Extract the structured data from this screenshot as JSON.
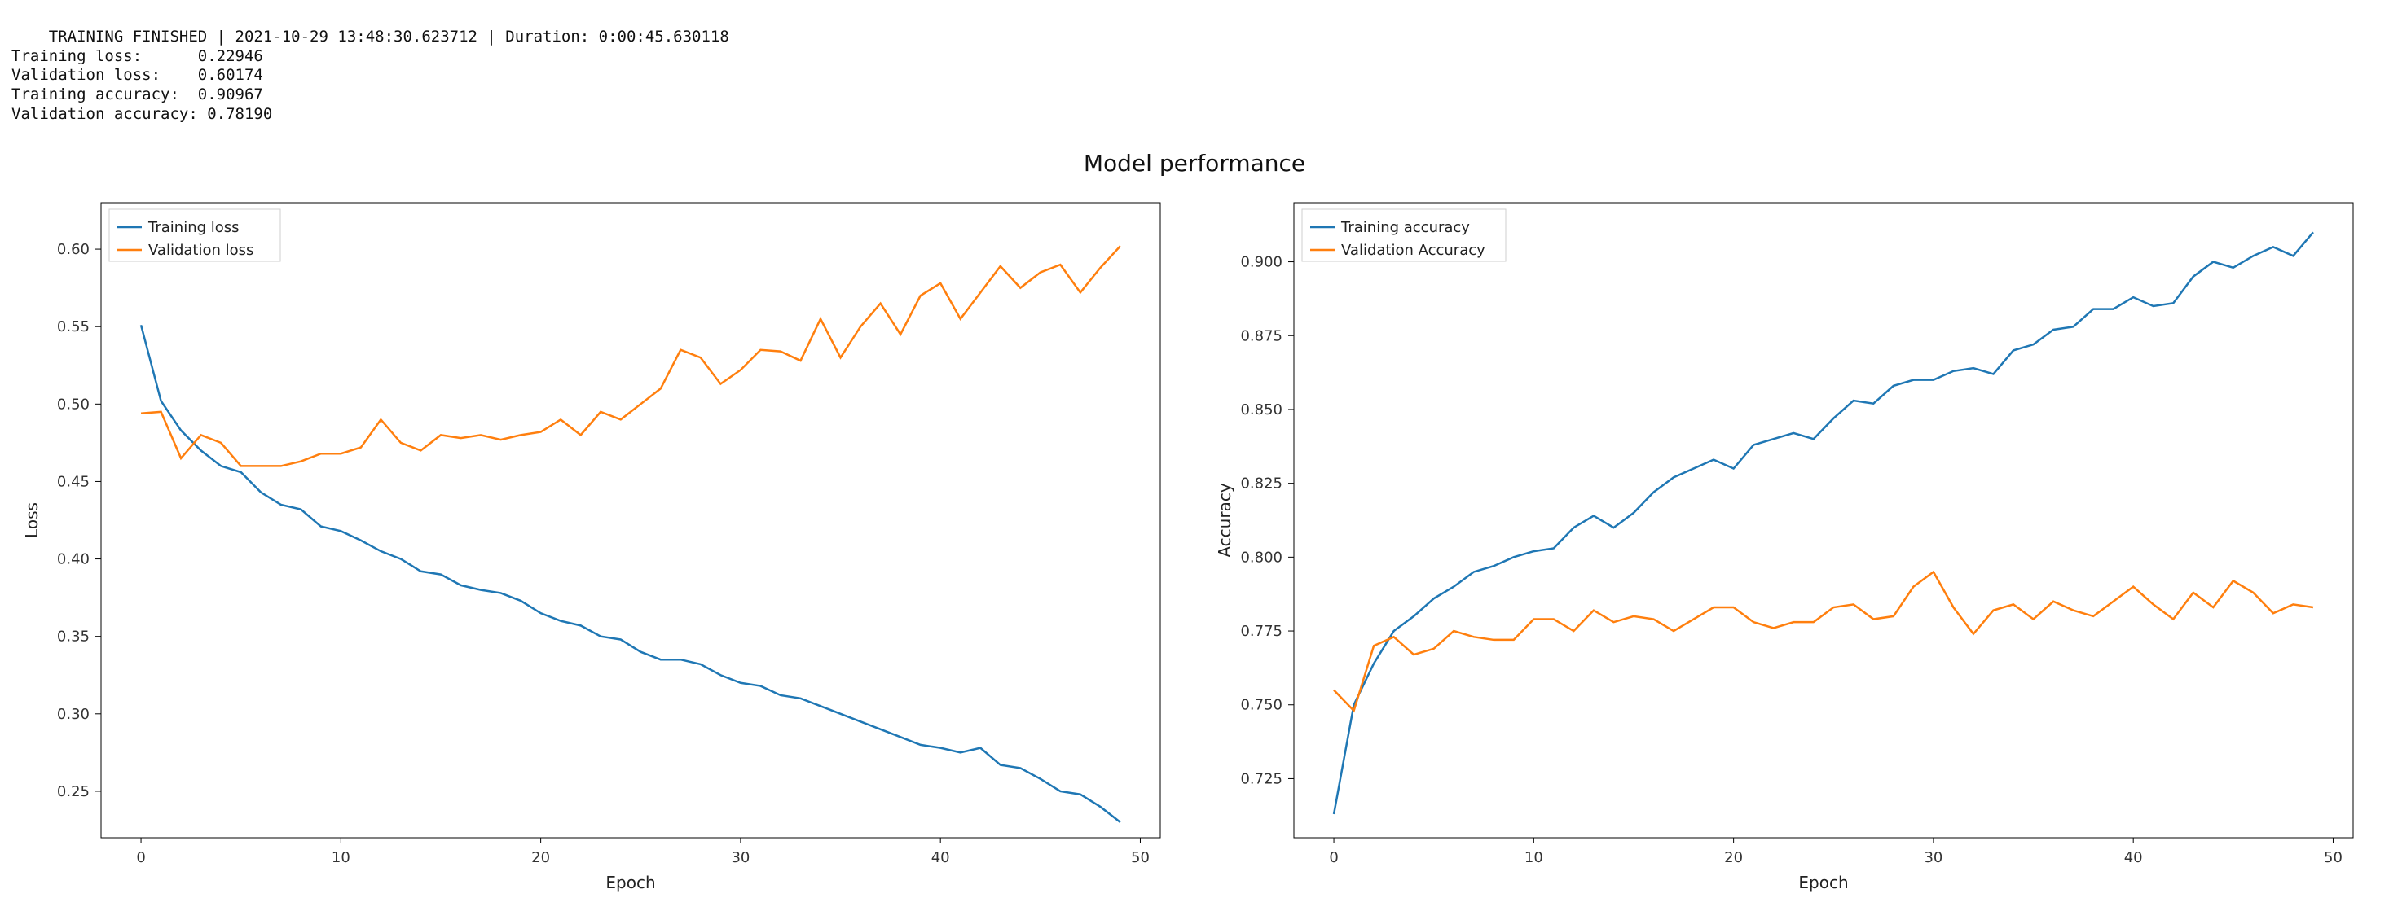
{
  "log": {
    "header": "TRAINING FINISHED | 2021-10-29 13:48:30.623712 | Duration: 0:00:45.630118",
    "rows": [
      {
        "label": "Training loss:",
        "pad": "      ",
        "value": "0.22946"
      },
      {
        "label": "Validation loss:",
        "pad": "    ",
        "value": "0.60174"
      },
      {
        "label": "Training accuracy:",
        "pad": "  ",
        "value": "0.90967"
      },
      {
        "label": "Validation accuracy:",
        "pad": " ",
        "value": "0.78190"
      }
    ]
  },
  "suptitle": "Model performance",
  "colors": {
    "series0": "#1f77b4",
    "series1": "#ff7f0e",
    "axis": "#000000"
  },
  "charts": [
    {
      "ylabel": "Loss",
      "xlabel": "Epoch",
      "xlim": [
        -2,
        51
      ],
      "xticks": [
        0,
        10,
        20,
        30,
        40,
        50
      ],
      "ylim": [
        0.22,
        0.63
      ],
      "yticks": [
        0.25,
        0.3,
        0.35,
        0.4,
        0.45,
        0.5,
        0.55,
        0.6
      ],
      "legend_pos": "upper-left",
      "series": [
        {
          "name": "Training loss",
          "color_key": "series0"
        },
        {
          "name": "Validation loss",
          "color_key": "series1"
        }
      ]
    },
    {
      "ylabel": "Accuracy",
      "xlabel": "Epoch",
      "xlim": [
        -2,
        51
      ],
      "xticks": [
        0,
        10,
        20,
        30,
        40,
        50
      ],
      "ylim": [
        0.705,
        0.92
      ],
      "yticks": [
        0.725,
        0.75,
        0.775,
        0.8,
        0.825,
        0.85,
        0.875,
        0.9
      ],
      "legend_pos": "upper-left",
      "series": [
        {
          "name": "Training accuracy",
          "color_key": "series0"
        },
        {
          "name": "Validation Accuracy",
          "color_key": "series1"
        }
      ]
    }
  ],
  "chart_data": [
    {
      "type": "line",
      "title": "",
      "xlabel": "Epoch",
      "ylabel": "Loss",
      "xlim": [
        -2,
        51
      ],
      "ylim": [
        0.22,
        0.63
      ],
      "x": [
        0,
        1,
        2,
        3,
        4,
        5,
        6,
        7,
        8,
        9,
        10,
        11,
        12,
        13,
        14,
        15,
        16,
        17,
        18,
        19,
        20,
        21,
        22,
        23,
        24,
        25,
        26,
        27,
        28,
        29,
        30,
        31,
        32,
        33,
        34,
        35,
        36,
        37,
        38,
        39,
        40,
        41,
        42,
        43,
        44,
        45,
        46,
        47,
        48,
        49
      ],
      "series": [
        {
          "name": "Training loss",
          "values": [
            0.551,
            0.502,
            0.483,
            0.47,
            0.46,
            0.456,
            0.443,
            0.435,
            0.432,
            0.421,
            0.418,
            0.412,
            0.405,
            0.4,
            0.392,
            0.39,
            0.383,
            0.38,
            0.378,
            0.373,
            0.365,
            0.36,
            0.357,
            0.35,
            0.348,
            0.34,
            0.335,
            0.335,
            0.332,
            0.325,
            0.32,
            0.318,
            0.312,
            0.31,
            0.305,
            0.3,
            0.295,
            0.29,
            0.285,
            0.28,
            0.278,
            0.275,
            0.278,
            0.267,
            0.265,
            0.258,
            0.25,
            0.248,
            0.24,
            0.23
          ]
        },
        {
          "name": "Validation loss",
          "values": [
            0.494,
            0.495,
            0.465,
            0.48,
            0.475,
            0.46,
            0.46,
            0.46,
            0.463,
            0.468,
            0.468,
            0.472,
            0.49,
            0.475,
            0.47,
            0.48,
            0.478,
            0.48,
            0.477,
            0.48,
            0.482,
            0.49,
            0.48,
            0.495,
            0.49,
            0.5,
            0.51,
            0.535,
            0.53,
            0.513,
            0.522,
            0.535,
            0.534,
            0.528,
            0.555,
            0.53,
            0.55,
            0.565,
            0.545,
            0.57,
            0.578,
            0.555,
            0.572,
            0.589,
            0.575,
            0.585,
            0.59,
            0.572,
            0.588,
            0.602
          ]
        }
      ]
    },
    {
      "type": "line",
      "title": "",
      "xlabel": "Epoch",
      "ylabel": "Accuracy",
      "xlim": [
        -2,
        51
      ],
      "ylim": [
        0.705,
        0.92
      ],
      "x": [
        0,
        1,
        2,
        3,
        4,
        5,
        6,
        7,
        8,
        9,
        10,
        11,
        12,
        13,
        14,
        15,
        16,
        17,
        18,
        19,
        20,
        21,
        22,
        23,
        24,
        25,
        26,
        27,
        28,
        29,
        30,
        31,
        32,
        33,
        34,
        35,
        36,
        37,
        38,
        39,
        40,
        41,
        42,
        43,
        44,
        45,
        46,
        47,
        48,
        49
      ],
      "series": [
        {
          "name": "Training accuracy",
          "values": [
            0.713,
            0.75,
            0.764,
            0.775,
            0.78,
            0.786,
            0.79,
            0.795,
            0.797,
            0.8,
            0.802,
            0.803,
            0.81,
            0.814,
            0.81,
            0.815,
            0.822,
            0.827,
            0.83,
            0.833,
            0.83,
            0.838,
            0.84,
            0.842,
            0.84,
            0.847,
            0.853,
            0.852,
            0.858,
            0.86,
            0.86,
            0.863,
            0.864,
            0.862,
            0.87,
            0.872,
            0.877,
            0.878,
            0.884,
            0.884,
            0.888,
            0.885,
            0.886,
            0.895,
            0.9,
            0.898,
            0.902,
            0.905,
            0.902,
            0.91
          ]
        },
        {
          "name": "Validation Accuracy",
          "values": [
            0.755,
            0.748,
            0.77,
            0.773,
            0.767,
            0.769,
            0.775,
            0.773,
            0.772,
            0.772,
            0.779,
            0.779,
            0.775,
            0.782,
            0.778,
            0.78,
            0.779,
            0.775,
            0.779,
            0.783,
            0.783,
            0.778,
            0.776,
            0.778,
            0.778,
            0.783,
            0.784,
            0.779,
            0.78,
            0.79,
            0.795,
            0.783,
            0.774,
            0.782,
            0.784,
            0.779,
            0.785,
            0.782,
            0.78,
            0.785,
            0.79,
            0.784,
            0.779,
            0.788,
            0.783,
            0.792,
            0.788,
            0.781,
            0.784,
            0.783
          ]
        }
      ]
    }
  ]
}
